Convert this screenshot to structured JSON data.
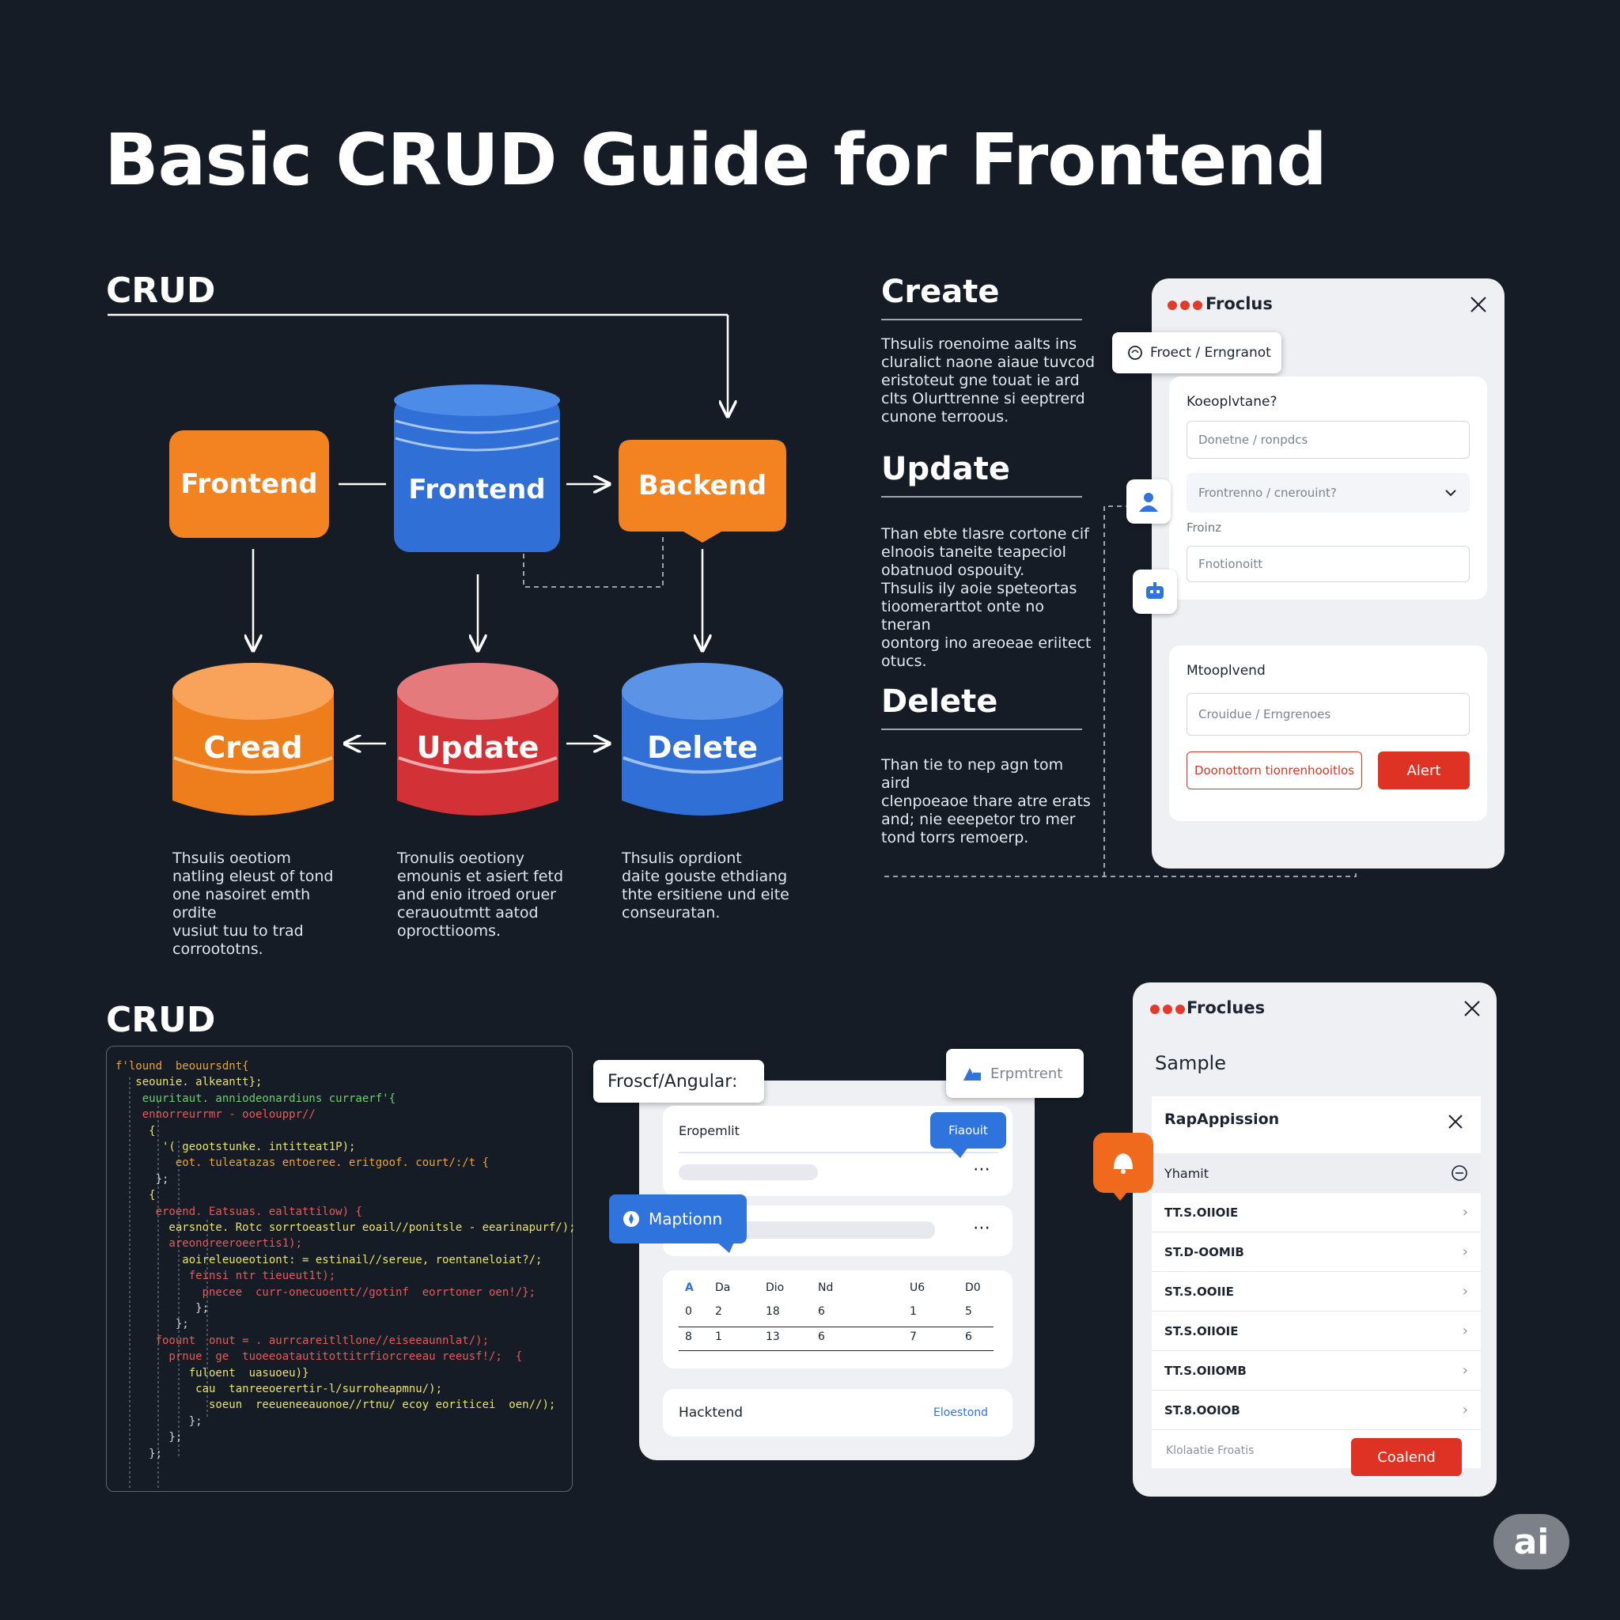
{
  "title": "Basic CRUD Guide for Frontend",
  "diagram": {
    "section_label": "CRUD",
    "nodes": {
      "frontend_left": "Frontend",
      "frontend_db": "Frontend",
      "backend": "Backend",
      "cread": "Cread",
      "update": "Update",
      "delete": "Delete"
    },
    "captions": {
      "cread": [
        "Thsulis oeotiom",
        "natling eleust of tond",
        "one nasoiret emth ordite",
        "vusiut tuu to trad",
        "corroototns."
      ],
      "update": [
        "Tronulis oeotiony",
        "emounis et asiert fetd",
        "and enio itroed oruer",
        "cerauoutmtt aatod",
        "oprocttiooms."
      ],
      "delete": [
        "Thsulis oprdiont",
        "daite gouste ethdiang",
        "thte ersitiene und eite",
        "conseuratan."
      ]
    },
    "colors": {
      "orange": "#f28320",
      "blue": "#2f73dd",
      "red": "#d9363a"
    }
  },
  "info_column": {
    "create": {
      "heading": "Create",
      "lines": [
        "Thsulis roenoime aalts ins",
        "cluralict naone aiaue tuvcod",
        "eristoteut gne touat ie ard",
        "clts Olurttrenne si eeptrerd",
        "cunone terroous."
      ]
    },
    "update": {
      "heading": "Update",
      "lines": [
        "Than ebte tlasre cortone cif",
        "elnoois taneite teapeciol",
        "obatnuod ospouity.",
        "Thsulis ily aoie speteortas",
        "tioomerarttot onte no tneran",
        "oontorg ino areoeae eriitect",
        "otucs."
      ]
    },
    "delete": {
      "heading": "Delete",
      "lines": [
        "Than tie to nep agn tom aird",
        "clenpoeaoe thare atre erats",
        "and; nie eeepetor tro mer",
        "tond torrs remoerp."
      ]
    }
  },
  "form_panel": {
    "title": "Froclus",
    "tag": "Froect / Erngranot",
    "card1": {
      "label": "Koeoplvtane?",
      "field1_placeholder": "Donetne / ronpdcs",
      "select_value": "Frontrenno / cnerouint?",
      "field2_label": "Froinz",
      "field2_placeholder": "Fnotionoitt"
    },
    "card2": {
      "label": "Mtooplvend",
      "field_placeholder": "Crouidue / Erngrenoes",
      "outline_button": "Doonottorn tionrenhooitlos",
      "primary_button": "Alert"
    },
    "icons": [
      "user-icon",
      "robot-icon",
      "close-icon"
    ]
  },
  "code_section": {
    "label": "CRUD",
    "lines": [
      {
        "text": "f'lound  beouursdnt{",
        "color": "#e8a33d"
      },
      {
        "text": "   seounie. alkeantt};",
        "color": "#e9e36a"
      },
      {
        "text": "    euuritaut. anniodeonardiuns curraerf'{",
        "color": "#6ad06a"
      },
      {
        "text": "    ennorreurrmr - ooelouppr//",
        "color": "#e75a5a"
      },
      {
        "text": "     {",
        "color": "#e9e36a"
      },
      {
        "text": "       '( geootstunke. intitteat1P);",
        "color": "#e9e36a"
      },
      {
        "text": "         eot. tuleatazas entoeree. eritgoof. court/:/t {",
        "color": "#e8a33d"
      },
      {
        "text": "      };",
        "color": "#cfd6df"
      },
      {
        "text": "     {",
        "color": "#e9e36a"
      },
      {
        "text": "      eroend. Eatsuas. ealtattilow) {",
        "color": "#e75a5a"
      },
      {
        "text": "        earsnote. Rotc sorrtoeastlur eoail//ponitsle - eearinapurf/);",
        "color": "#e9e36a"
      },
      {
        "text": "        areonoreeroeertis1);",
        "color": "#e75a5a"
      },
      {
        "text": "          aoireleuoeotiont: = estinail//sereue, roentaneloiat?/;",
        "color": "#e9e36a"
      },
      {
        "text": "           feinsi ntr tieueut1t);",
        "color": "#e75a5a"
      },
      {
        "text": "             pnecee  curr-onecuoentt//gotinf  eorrtoner oen!/};",
        "color": "#e75a5a"
      },
      {
        "text": "            };",
        "color": "#cfd6df"
      },
      {
        "text": "         };",
        "color": "#cfd6df"
      },
      {
        "text": "      foount  onut = . aurrcareitltlone//eiseeaunnlat/);",
        "color": "#e75a5a"
      },
      {
        "text": "        prnue  ge  tuoeeoatautitottitrfiorcreeau reeusf!/;  {",
        "color": "#e75a5a"
      },
      {
        "text": "           fuloent  uasuoeu)}",
        "color": "#e9e36a"
      },
      {
        "text": "            cau  tanreeoerertir-l/surroheapmnu/);",
        "color": "#e9e36a"
      },
      {
        "text": "              soeun  reeueneeauonoe//rtnu/ ecoy eoriticei  oen//);",
        "color": "#e9e36a"
      },
      {
        "text": "           };",
        "color": "#cfd6df"
      },
      {
        "text": "        };",
        "color": "#cfd6df"
      },
      {
        "text": "     };",
        "color": "#cfd6df"
      }
    ]
  },
  "mid_panel": {
    "header_tag": "Froscf/Angular:",
    "floating_tag": "Erpmtrent",
    "card_label": "Eropemlit",
    "blue_tag": "Fiaouit",
    "map_tag": "Maptionn",
    "table": {
      "headers": [
        "A",
        "Da",
        "Dio",
        "Nd",
        "U6",
        "D0"
      ],
      "rows": [
        [
          "0",
          "2",
          "18",
          "6",
          "1",
          "5"
        ],
        [
          "8",
          "1",
          "13",
          "6",
          "7",
          "6"
        ]
      ]
    },
    "footer_label": "Hacktend",
    "footer_link": "Eloestond"
  },
  "list_panel": {
    "title": "Froclues",
    "subtitle": "Sample",
    "sub_header": "RapAppission",
    "selected": "Yhamit",
    "items": [
      "TT.S.OIIOIE",
      "ST.D-OOMIB",
      "ST.S.OOIIE",
      "ST.S.OIIOIE",
      "TT.S.OIIOMB",
      "ST.8.OOIOB"
    ],
    "footer_text": "Klolaatie Froatis",
    "footer_button": "Coalend"
  },
  "badge": "ai"
}
